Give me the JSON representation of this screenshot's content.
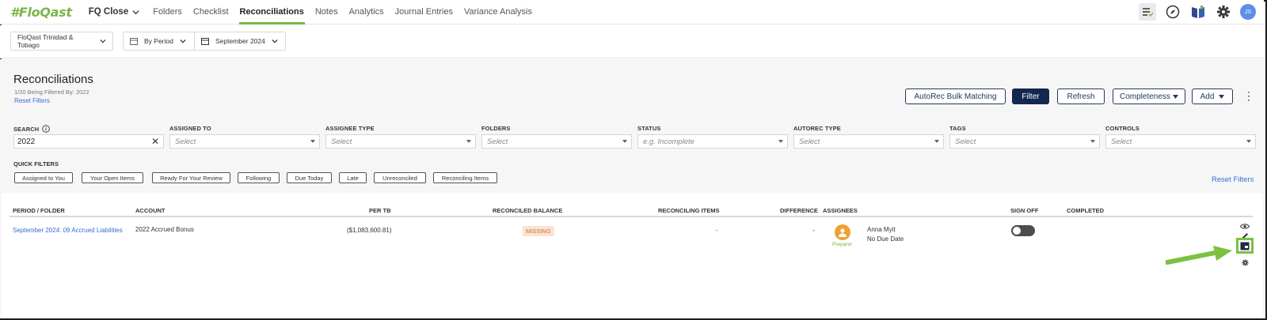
{
  "nav": {
    "logo": "FloQast",
    "workspace": "FQ Close",
    "links": [
      "Folders",
      "Checklist",
      "Reconciliations",
      "Notes",
      "Analytics",
      "Journal Entries",
      "Variance Analysis"
    ],
    "active_index": 2,
    "avatar": "JS",
    "icons": [
      "checklist-icon",
      "compass-icon",
      "book-icon",
      "gear-icon"
    ]
  },
  "context": {
    "entity": "FloQast Trinidad & Tobago",
    "view": "By Period",
    "period": "September 2024"
  },
  "page": {
    "title": "Reconciliations",
    "filtered_note": "1/20 Being Filtered By: 2022",
    "reset_filters": "Reset Filters"
  },
  "actions": {
    "autorec": "AutoRec Bulk Matching",
    "filter": "Filter",
    "refresh": "Refresh",
    "completeness": "Completeness",
    "add": "Add"
  },
  "filters": {
    "search_label": "SEARCH",
    "search_value": "2022",
    "fields": [
      {
        "label": "ASSIGNED TO",
        "placeholder": "Select"
      },
      {
        "label": "ASSIGNEE TYPE",
        "placeholder": "Select"
      },
      {
        "label": "FOLDERS",
        "placeholder": "Select"
      },
      {
        "label": "STATUS",
        "placeholder": "e.g. Incomplete"
      },
      {
        "label": "AUTOREC TYPE",
        "placeholder": "Select"
      },
      {
        "label": "TAGS",
        "placeholder": "Select"
      },
      {
        "label": "CONTROLS",
        "placeholder": "Select"
      }
    ],
    "quick_filters_label": "QUICK FILTERS",
    "quick_filters": [
      "Assigned to You",
      "Your Open Items",
      "Ready For Your Review",
      "Following",
      "Due Today",
      "Late",
      "Unreconciled",
      "Reconciling Items"
    ],
    "reset_filters": "Reset Filters"
  },
  "table": {
    "headers": [
      "PERIOD / FOLDER",
      "ACCOUNT",
      "PER TB",
      "RECONCILED BALANCE",
      "RECONCILING ITEMS",
      "DIFFERENCE",
      "ASSIGNEES",
      "SIGN OFF",
      "COMPLETED"
    ],
    "row": {
      "period_folder": "September 2024: 09 Accrued Liabilities",
      "account": "2022 Accrued Bonus",
      "per_tb": "($1,083,600.81)",
      "reconciled_balance": "MISSING",
      "reconciling_items": "-",
      "difference": "-",
      "assignee_role": "Preparer",
      "assignee_name": "Anna Myit",
      "due": "No Due Date"
    }
  },
  "colors": {
    "brand_green": "#7ab648",
    "primary_navy": "#14274e",
    "link_blue": "#3b6bd6",
    "missing_bg": "#fbe3d3",
    "missing_text": "#d5702d",
    "arrow_green": "#7cc142"
  }
}
